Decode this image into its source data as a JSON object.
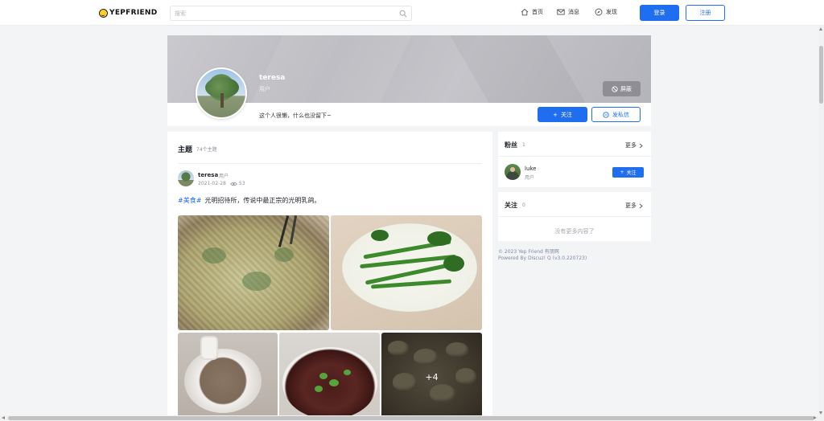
{
  "header": {
    "logo_text": "YEPFRIEND",
    "search_placeholder": "搜索",
    "nav": {
      "home": "首页",
      "messages": "消息",
      "discover": "发现"
    },
    "login_label": "登录",
    "register_label": "注册"
  },
  "profile": {
    "name": "teresa",
    "role": "用户",
    "bio": "这个人很懒，什么也没留下~",
    "block_label": "屏蔽",
    "follow_label": "关注",
    "message_label": "发私信"
  },
  "topics": {
    "title": "主题",
    "count": "74个主题",
    "post": {
      "author": "teresa",
      "role": "用户",
      "date": "2021-02-28",
      "views": "53",
      "tag": "#美食#",
      "text": "光明招待所，传说中最正宗的光明乳鸽。",
      "more_images": "+4"
    }
  },
  "sidebar": {
    "fans": {
      "title": "粉丝",
      "count": "1",
      "more_label": "更多",
      "items": [
        {
          "name": "luke",
          "role": "用户",
          "follow_label": "关注"
        }
      ]
    },
    "following": {
      "title": "关注",
      "count": "0",
      "more_label": "更多",
      "empty_text": "没有更多内容了"
    },
    "footer": {
      "copyright": "© 2023 Yep Friend 有朋网",
      "powered": "Powered By Discuz! Q (v3.0.220723)"
    }
  },
  "icons": {
    "search": "search-icon",
    "home": "home-icon",
    "mail": "mail-icon",
    "discover": "compass-icon",
    "block": "block-icon",
    "message": "chat-icon",
    "views": "eye-icon",
    "more": "chevron-right-icon"
  },
  "colors": {
    "accent": "#1f6ef0",
    "tag": "#1f6ef0"
  }
}
